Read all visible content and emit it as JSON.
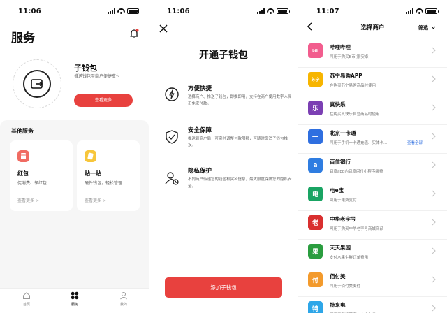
{
  "screen1": {
    "status_time": "11:06",
    "title": "服务",
    "wallet": {
      "name": "子钱包",
      "desc": "推送钱包至商户便捷支付",
      "button": "查看更多"
    },
    "other_services": {
      "title": "其他服务",
      "cards": [
        {
          "name": "红包",
          "desc": "促消费、領红包",
          "more": "查看更多 >",
          "color": "#f06b62"
        },
        {
          "name": "贴一贴",
          "desc": "硬件钱包，轻松管理",
          "more": "查看更多 >",
          "color": "#f7c63b"
        }
      ]
    },
    "tabbar": [
      {
        "label": "首页",
        "icon": "home-icon"
      },
      {
        "label": "服务",
        "icon": "services-grid-icon"
      },
      {
        "label": "我的",
        "icon": "profile-icon"
      }
    ]
  },
  "screen2": {
    "status_time": "11:06",
    "title": "开通子钱包",
    "features": [
      {
        "name": "方便快捷",
        "desc": "选择商户、推送子钱包，即推即用，支持在商户使用数字人民币免密付款。",
        "icon": "lightning-icon"
      },
      {
        "name": "安全保障",
        "desc": "推送到商户后，可实时调整付款限额，可随时取消子钱包推送。",
        "icon": "shield-check-icon"
      },
      {
        "name": "隐私保护",
        "desc": "不向商户传递您的钱包和实名信息，最大限度保障您的隐私安全。",
        "icon": "privacy-user-icon"
      }
    ],
    "button": "添加子钱包"
  },
  "screen3": {
    "status_time": "11:07",
    "title": "选择商户",
    "filter": "筛选",
    "merchants": [
      {
        "name": "哔哩哔哩",
        "desc": "可用于购买B币(限安卓)",
        "logo_text": "bili",
        "color": "#f25d8e"
      },
      {
        "name": "苏宁易购APP",
        "desc": "在购买苏宁易购商品时使用",
        "logo_text": "苏宁",
        "color": "#f7b500"
      },
      {
        "name": "真快乐",
        "desc": "在购买真快乐自营商品时使用",
        "logo_text": "乐",
        "color": "#7b3fb3"
      },
      {
        "name": "北京一卡通",
        "desc": "可用于手机一卡通充值、实体卡...",
        "extra": "查看全部",
        "logo_text": "一",
        "color": "#2f6fe0"
      },
      {
        "name": "百信银行",
        "desc": "百度app内百度闪付小程序缴费",
        "logo_text": "a",
        "color": "#2f7de1"
      },
      {
        "name": "电e宝",
        "desc": "可用于电费支付",
        "logo_text": "电",
        "color": "#19a463"
      },
      {
        "name": "中华老字号",
        "desc": "可用于购买中华老字号商城商品",
        "logo_text": "老",
        "color": "#d92f2f"
      },
      {
        "name": "天天果园",
        "desc": "支付水果生鲜订单费用",
        "logo_text": "果",
        "color": "#2a9d3f"
      },
      {
        "name": "佰付美",
        "desc": "可用于佰付美支付",
        "logo_text": "付",
        "color": "#f39a2c"
      },
      {
        "name": "特来电",
        "desc": "可用于新能源汽车充电支付",
        "logo_text": "特",
        "color": "#2ea6e8"
      }
    ]
  }
}
